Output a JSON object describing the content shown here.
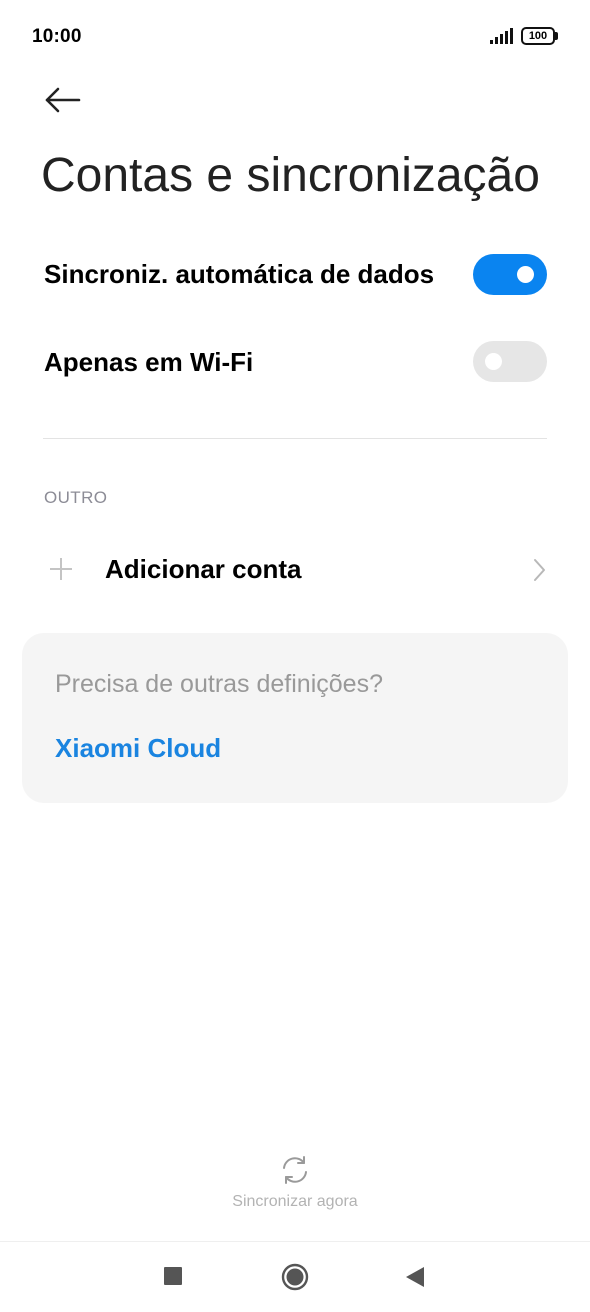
{
  "status_bar": {
    "time": "10:00",
    "battery": "100"
  },
  "page": {
    "title": "Contas e sincronização"
  },
  "settings": [
    {
      "label": "Sincroniz. automática de dados",
      "enabled": true
    },
    {
      "label": "Apenas em Wi-Fi",
      "enabled": false
    }
  ],
  "other_section": {
    "header": "OUTRO",
    "add_account_label": "Adicionar conta"
  },
  "cloud_card": {
    "question": "Precisa de outras definições?",
    "link": "Xiaomi Cloud"
  },
  "sync": {
    "label": "Sincronizar agora"
  },
  "colors": {
    "accent": "#0a84f0",
    "link": "#1a84e0"
  },
  "icons": [
    "signal-icon",
    "battery-icon",
    "back-arrow-icon",
    "plus-icon",
    "chevron-right-icon",
    "sync-icon",
    "nav-recents-icon",
    "nav-home-icon",
    "nav-back-icon"
  ]
}
